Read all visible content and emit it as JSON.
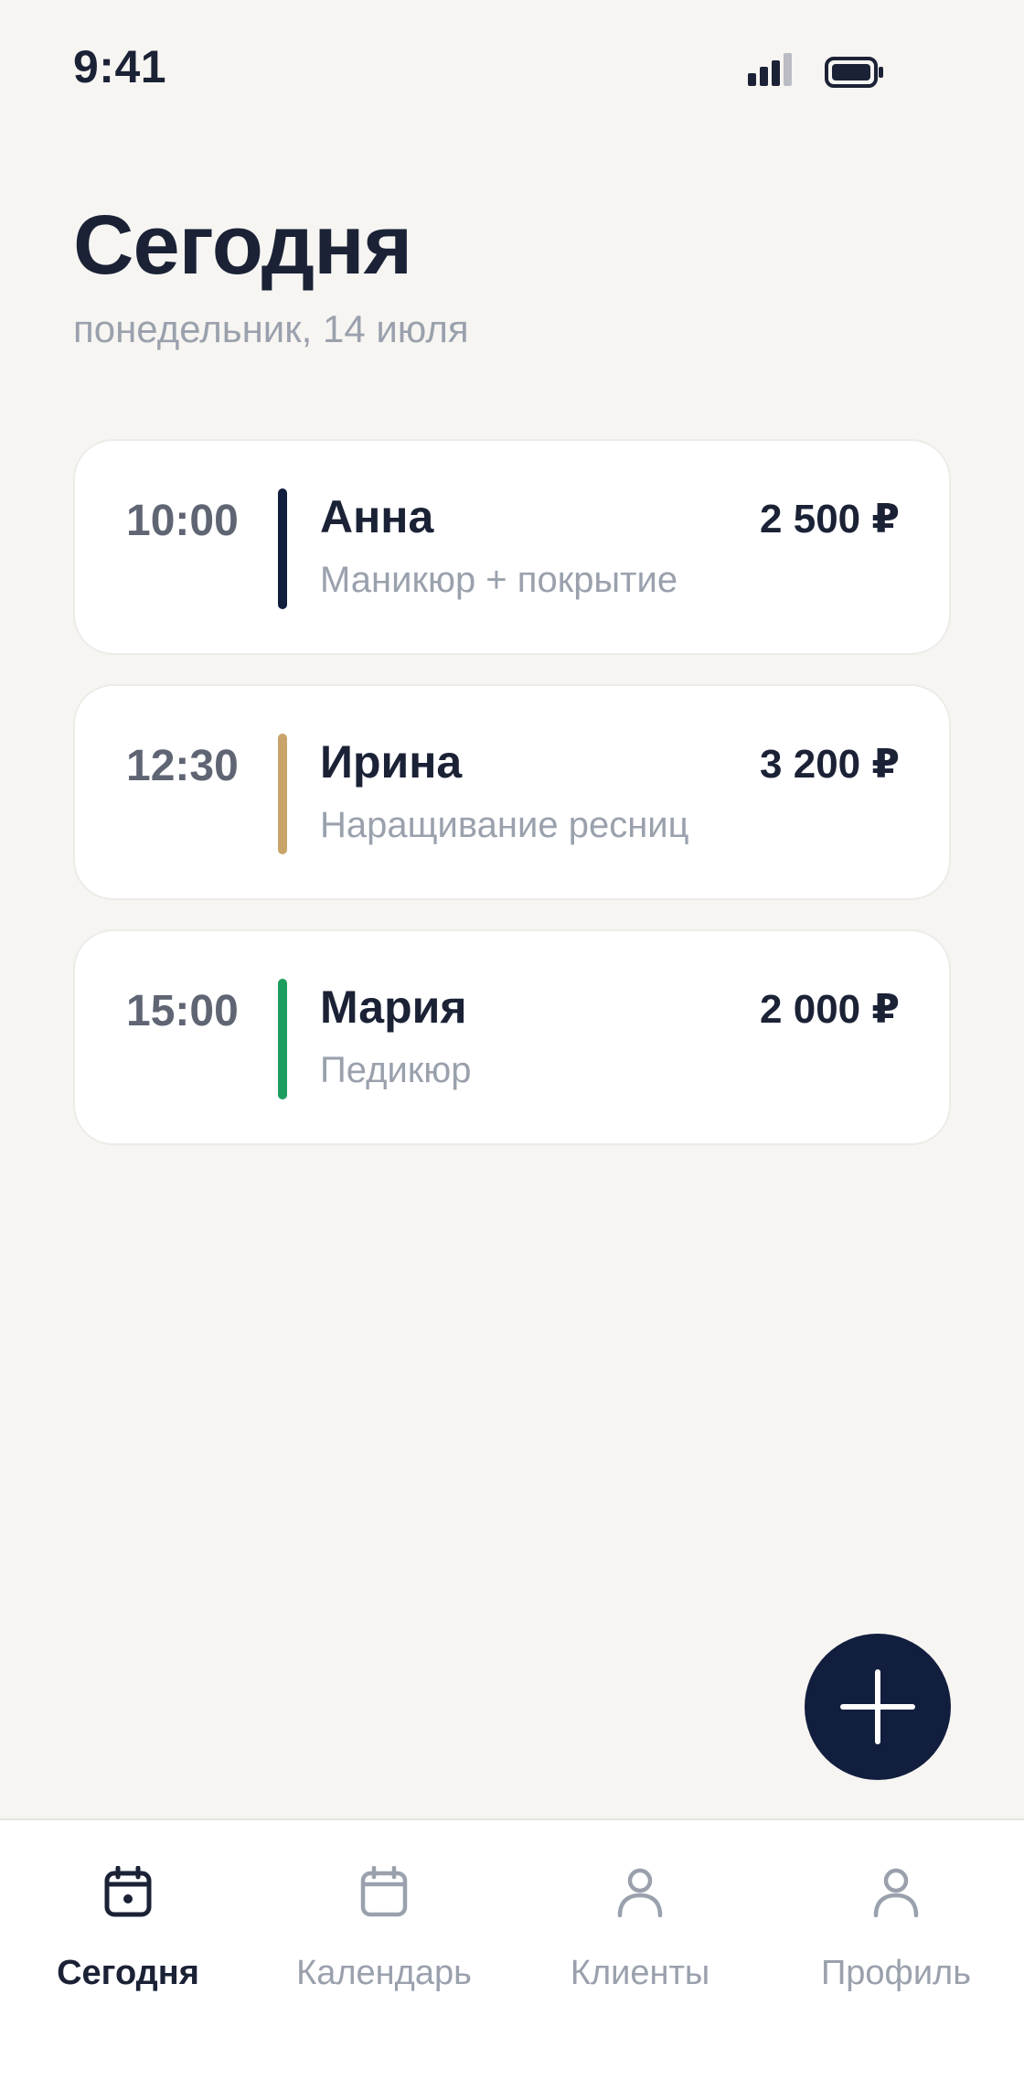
{
  "status_bar": {
    "time": "9:41",
    "signal_icon": "cellular-signal-icon",
    "battery_icon": "battery-icon"
  },
  "header": {
    "title": "Сегодня",
    "subtitle": "понедельник, 14 июля"
  },
  "appointments": [
    {
      "time": "10:00",
      "name": "Анна",
      "service": "Маникюр + покрытие",
      "price": "2 500 ₽",
      "accent_color": "#121E3E"
    },
    {
      "time": "12:30",
      "name": "Ирина",
      "service": "Наращивание ресниц",
      "price": "3 200 ₽",
      "accent_color": "#C8A46A"
    },
    {
      "time": "15:00",
      "name": "Мария",
      "service": "Педикюр",
      "price": "2 000 ₽",
      "accent_color": "#1E9E5E"
    }
  ],
  "fab": {
    "icon": "plus-icon"
  },
  "bottom_nav": {
    "items": [
      {
        "label": "Сегодня",
        "icon": "calendar-today-icon",
        "active": true
      },
      {
        "label": "Календарь",
        "icon": "calendar-icon",
        "active": false
      },
      {
        "label": "Клиенты",
        "icon": "person-icon",
        "active": false
      },
      {
        "label": "Профиль",
        "icon": "person-icon",
        "active": false
      }
    ]
  },
  "colors": {
    "background": "#F7F5F2",
    "primary": "#121E3E",
    "muted_text": "#9AA1AD",
    "time_text": "#5F6573"
  }
}
